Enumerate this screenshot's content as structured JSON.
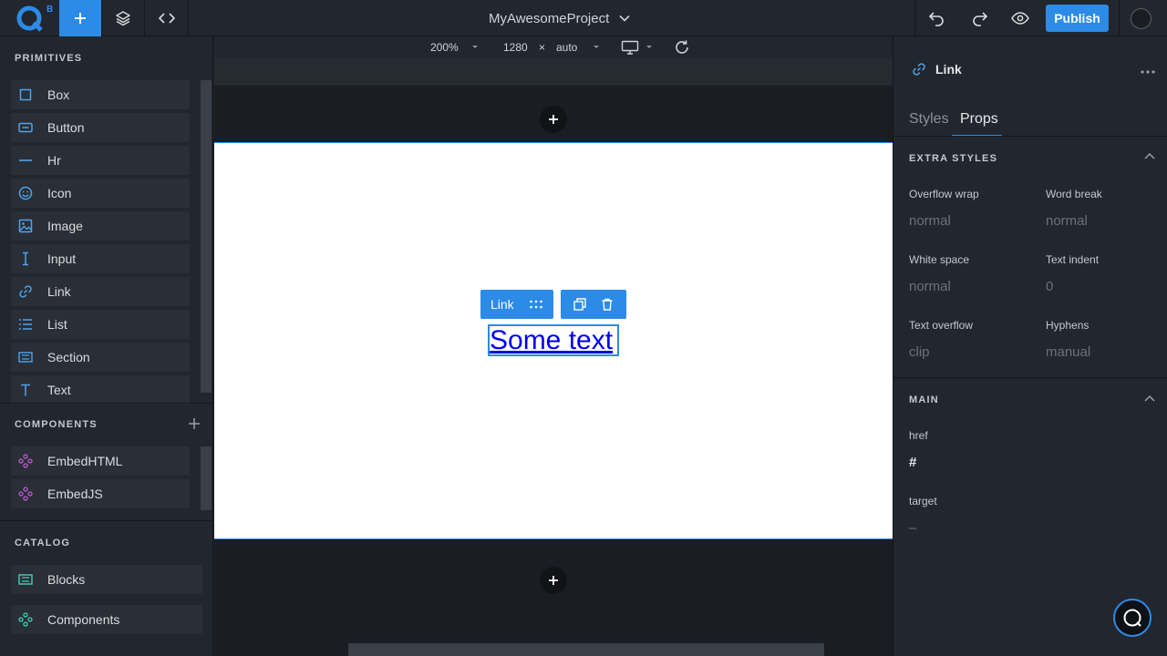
{
  "app": {
    "logo_badge": "B",
    "project_name": "MyAwesomeProject",
    "publish_label": "Publish"
  },
  "canvas_toolbar": {
    "zoom": "200%",
    "width": "1280",
    "times": "×",
    "height": "auto"
  },
  "sidebar": {
    "primitives_title": "PRIMITIVES",
    "primitives": [
      {
        "label": "Box",
        "icon": "box-icon"
      },
      {
        "label": "Button",
        "icon": "button-icon"
      },
      {
        "label": "Hr",
        "icon": "hr-icon"
      },
      {
        "label": "Icon",
        "icon": "smiley-icon"
      },
      {
        "label": "Image",
        "icon": "image-icon"
      },
      {
        "label": "Input",
        "icon": "text-cursor-icon"
      },
      {
        "label": "Link",
        "icon": "link-icon"
      },
      {
        "label": "List",
        "icon": "list-icon"
      },
      {
        "label": "Section",
        "icon": "section-icon"
      },
      {
        "label": "Text",
        "icon": "text-icon"
      }
    ],
    "components_title": "COMPONENTS",
    "components": [
      {
        "label": "EmbedHTML",
        "icon": "component-icon"
      },
      {
        "label": "EmbedJS",
        "icon": "component-icon"
      }
    ],
    "catalog_title": "CATALOG",
    "catalog": [
      {
        "label": "Blocks",
        "icon": "blocks-icon"
      },
      {
        "label": "Components",
        "icon": "component-icon"
      }
    ]
  },
  "canvas": {
    "selected_label": "Link",
    "link_text": "Some text"
  },
  "right_panel": {
    "element_name": "Link",
    "tabs": [
      "Styles",
      "Props"
    ],
    "active_tab": "Props",
    "extra_styles_title": "EXTRA STYLES",
    "extra_styles": [
      {
        "label": "Overflow wrap",
        "value": "normal"
      },
      {
        "label": "Word break",
        "value": "normal"
      },
      {
        "label": "White space",
        "value": "normal"
      },
      {
        "label": "Text indent",
        "value": "0"
      },
      {
        "label": "Text overflow",
        "value": "clip"
      },
      {
        "label": "Hyphens",
        "value": "manual"
      }
    ],
    "main_title": "MAIN",
    "main": [
      {
        "label": "href",
        "value": "#"
      },
      {
        "label": "target",
        "value": "–"
      }
    ]
  },
  "colors": {
    "accent": "#2b8be6",
    "component_purple": "#c05ad8",
    "catalog_teal": "#3fd3b3"
  }
}
